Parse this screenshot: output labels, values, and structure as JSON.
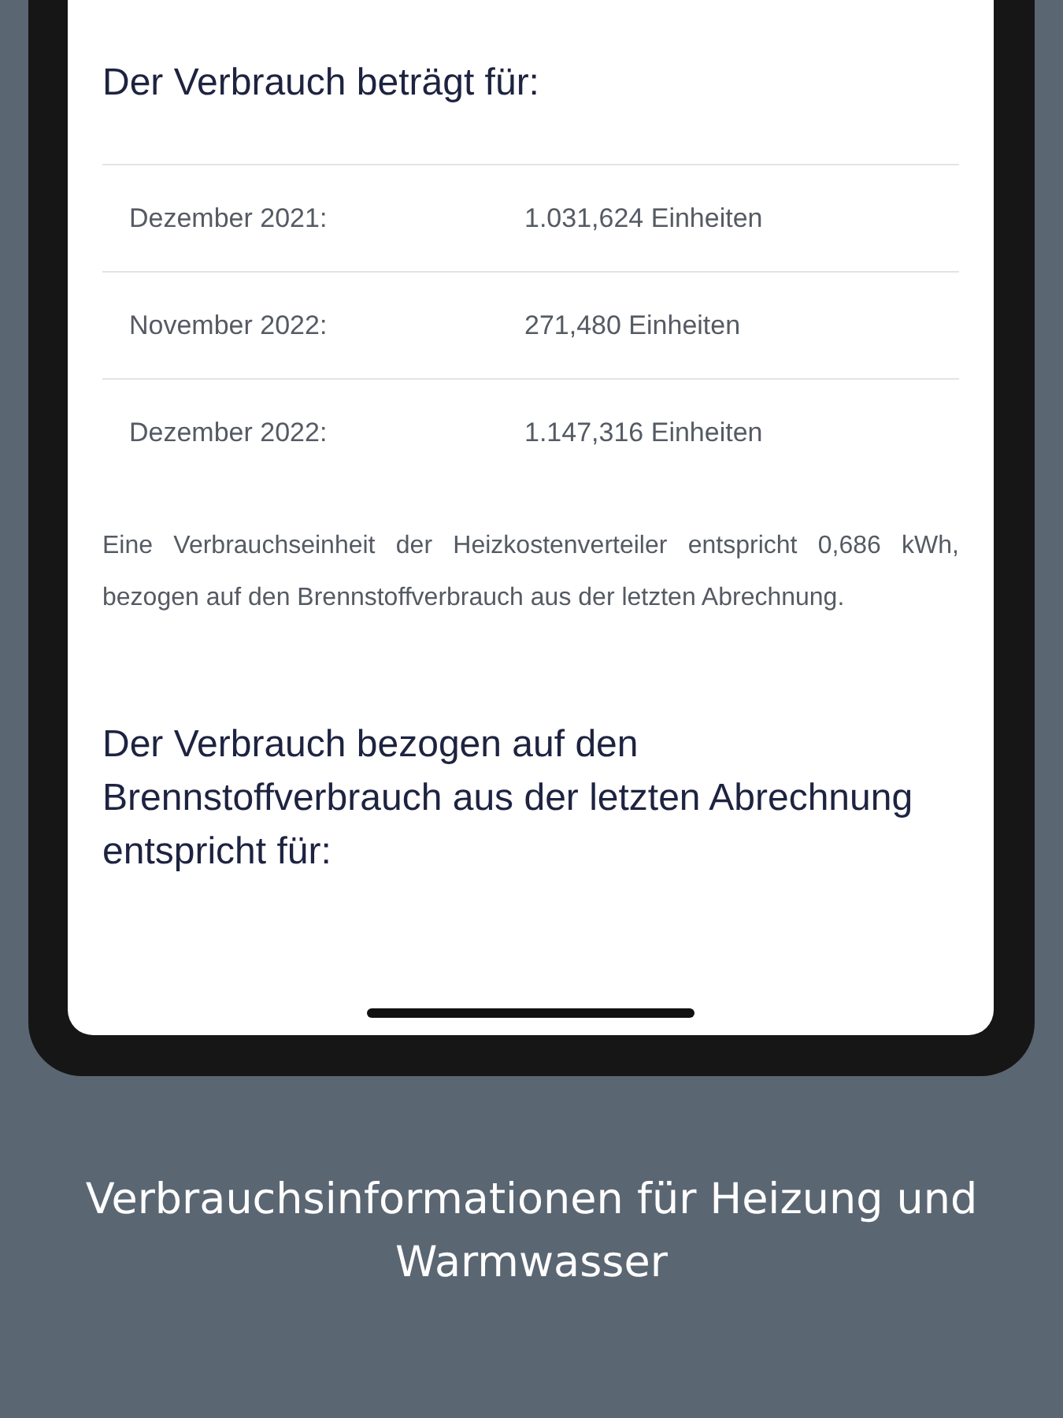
{
  "screen": {
    "heading": "Der Verbrauch beträgt für:",
    "rows": [
      {
        "period": "Dezember 2021:",
        "value": "1.031,624 Einheiten"
      },
      {
        "period": "November 2022:",
        "value": "271,480 Einheiten"
      },
      {
        "period": "Dezember 2022:",
        "value": "1.147,316 Einheiten"
      }
    ],
    "note": "Eine Verbrauchseinheit der Heizkostenverteiler entspricht 0,686 kWh, bezogen auf den Brennstoffverbrauch aus der letzten Abrechnung.",
    "heading_2": "Der Verbrauch bezogen auf den Brennstoffverbrauch aus der letzten Abrechnung entspricht für:"
  },
  "caption": "Verbrauchsinformationen für Heizung und Warmwasser"
}
